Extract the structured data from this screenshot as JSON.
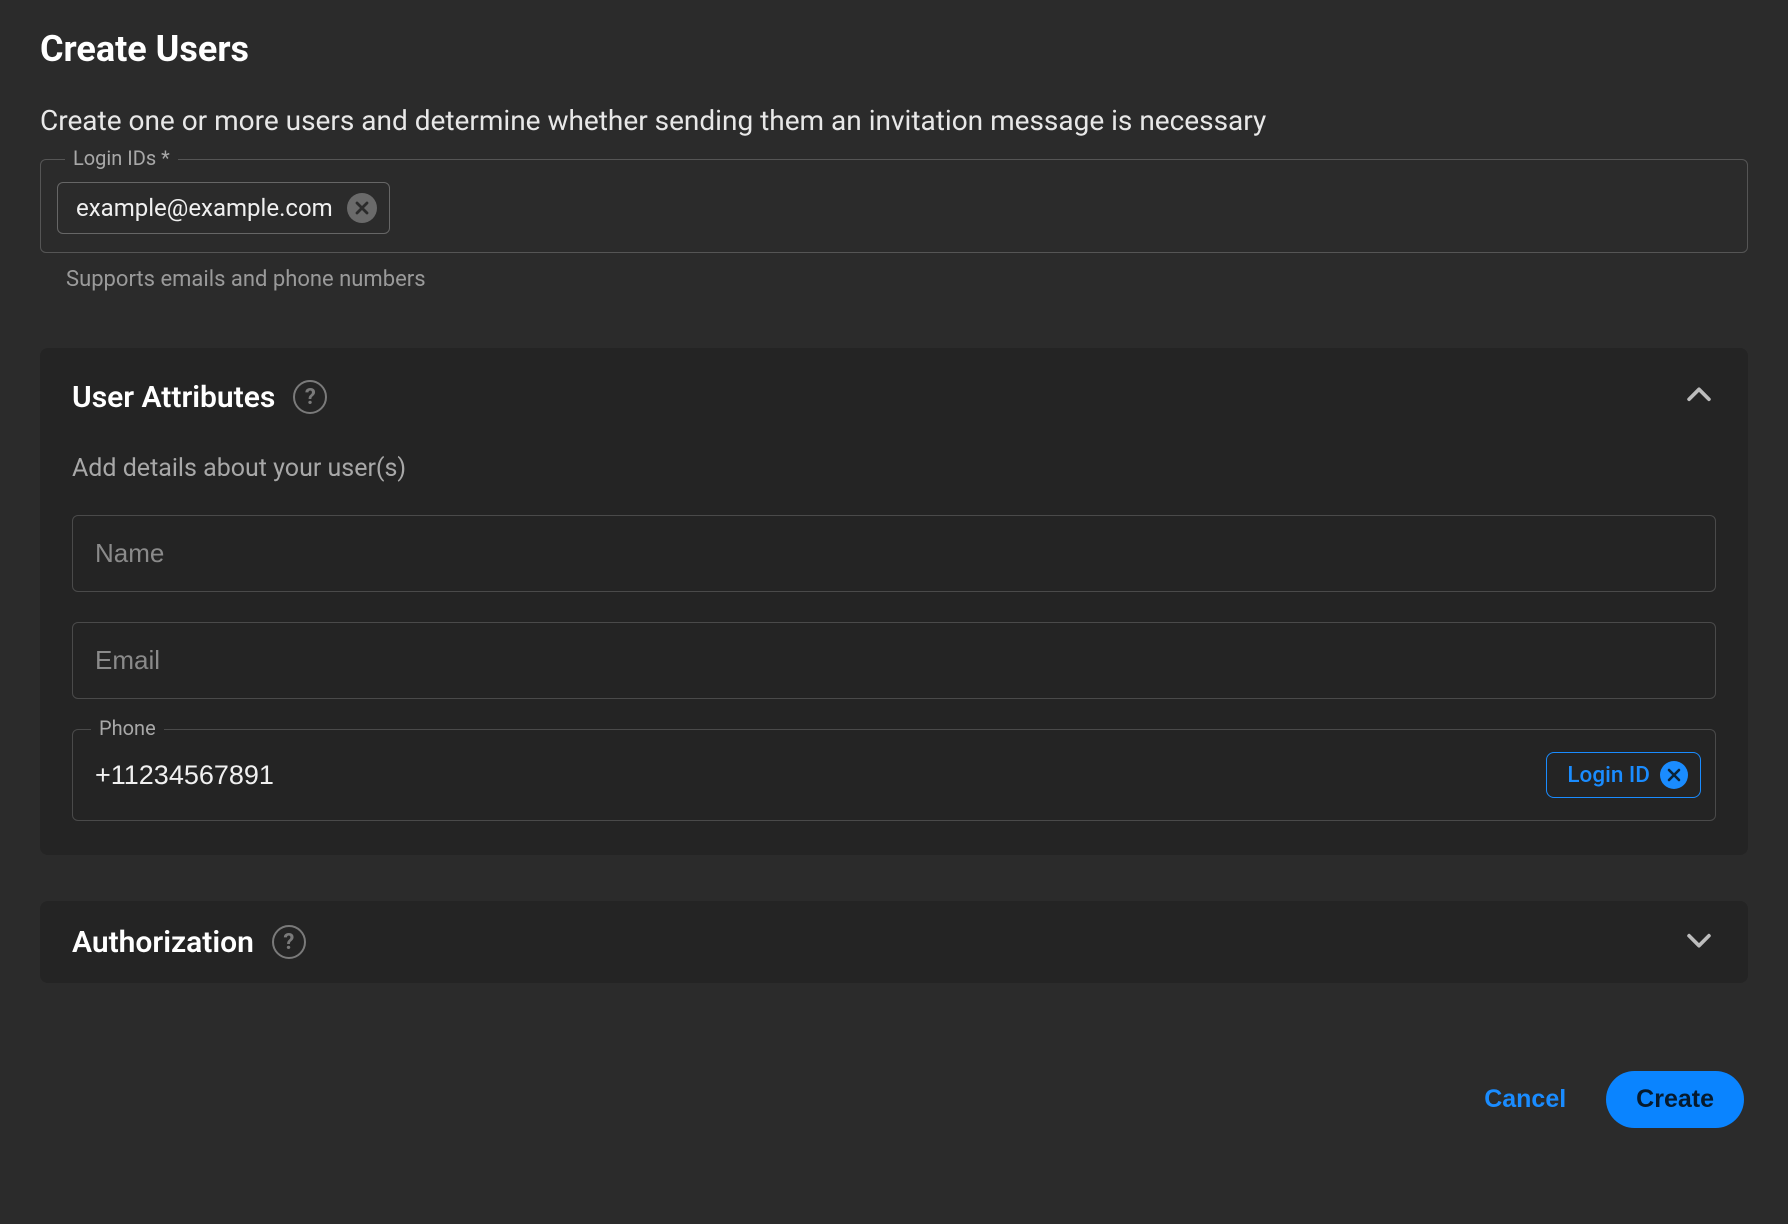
{
  "header": {
    "title": "Create Users",
    "subtitle": "Create one or more users and determine whether sending them an invitation message is necessary"
  },
  "loginIds": {
    "label": "Login IDs *",
    "chips": [
      "example@example.com"
    ],
    "helper": "Supports emails and phone numbers"
  },
  "userAttributes": {
    "title": "User Attributes",
    "subtitle": "Add details about your user(s)",
    "expanded": true,
    "fields": {
      "namePlaceholder": "Name",
      "nameValue": "",
      "emailPlaceholder": "Email",
      "emailValue": "",
      "phoneLabel": "Phone",
      "phoneValue": "+11234567891",
      "loginIdTagLabel": "Login ID"
    }
  },
  "authorization": {
    "title": "Authorization",
    "expanded": false
  },
  "footer": {
    "cancel": "Cancel",
    "create": "Create"
  }
}
